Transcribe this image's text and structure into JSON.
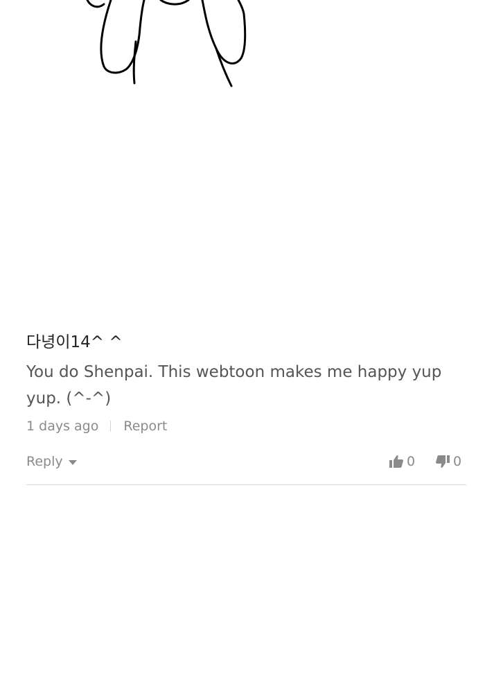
{
  "comment": {
    "author": "다녕이14^ ^",
    "text": "You do Shenpai. This webtoon makes me happy yup yup. (^-^)",
    "timestamp": "1 days ago",
    "report_label": "Report",
    "reply_label": "Reply",
    "likes": "0",
    "dislikes": "0"
  },
  "icons": {
    "reply_caret": "chevron-down-icon",
    "like": "thumbs-up-icon",
    "dislike": "thumbs-down-icon"
  },
  "colors": {
    "author": "#222222",
    "text": "#555555",
    "meta": "#8a8a8a",
    "divider": "#d9d9d9"
  }
}
